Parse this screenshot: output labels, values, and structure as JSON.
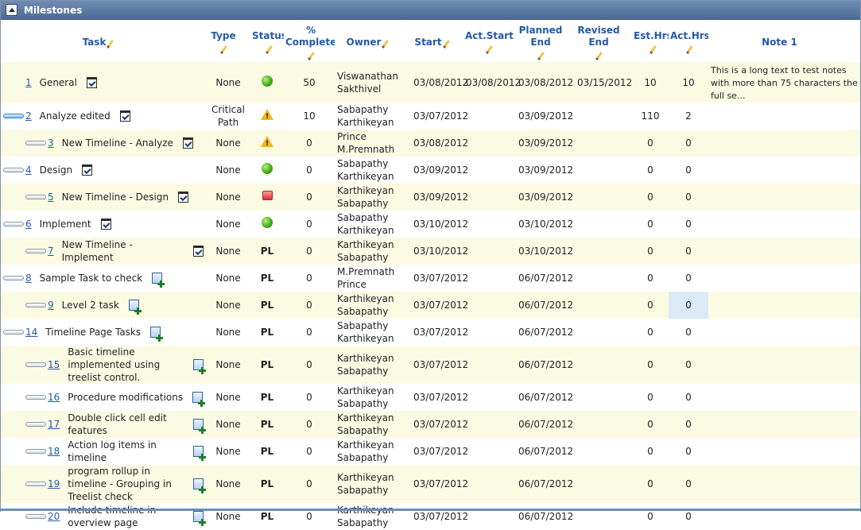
{
  "panel": {
    "title": "Milestones"
  },
  "columns": {
    "task": "Task",
    "type": "Type",
    "status": "Status",
    "complete": "% Complete",
    "owner": "Owner",
    "start": "Start",
    "act_start": "Act.Start",
    "planned_end": "Planned End",
    "revised_end": "Revised End",
    "est_hrs": "Est.Hrs",
    "act_hrs": "Act.Hrs",
    "note": "Note 1"
  },
  "rows": [
    {
      "num": "1",
      "name": "General",
      "icon": "checklist-icon",
      "expander": "none",
      "indent": 0,
      "type": "None",
      "status": "green",
      "status_text": "",
      "complete": "50",
      "owner": "Viswanathan Sakthivel",
      "start": "03/08/2012",
      "act_start": "03/08/2012",
      "planned_end": "03/08/2012",
      "revised_end": "03/15/2012",
      "est_hrs": "10",
      "act_hrs": "10",
      "note": "This is a long text to test notes with more than 75 characters the full se..."
    },
    {
      "num": "2",
      "name": "Analyze edited",
      "icon": "checklist-icon",
      "expander": "active",
      "indent": 0,
      "type": "Critical Path",
      "status": "warning",
      "status_text": "",
      "complete": "10",
      "owner": "Sabapathy Karthikeyan",
      "start": "03/07/2012",
      "act_start": "",
      "planned_end": "03/09/2012",
      "revised_end": "",
      "est_hrs": "110",
      "act_hrs": "2",
      "note": ""
    },
    {
      "num": "3",
      "name": "New Timeline - Analyze",
      "icon": "checklist-icon",
      "expander": "normal",
      "indent": 1,
      "type": "None",
      "status": "warning",
      "status_text": "",
      "complete": "0",
      "owner": "Prince M.Premnath",
      "start": "03/08/2012",
      "act_start": "",
      "planned_end": "03/09/2012",
      "revised_end": "",
      "est_hrs": "0",
      "act_hrs": "0",
      "note": ""
    },
    {
      "num": "4",
      "name": "Design",
      "icon": "checklist-icon",
      "expander": "normal",
      "indent": 0,
      "type": "None",
      "status": "green",
      "status_text": "",
      "complete": "0",
      "owner": "Sabapathy Karthikeyan",
      "start": "03/09/2012",
      "act_start": "",
      "planned_end": "03/09/2012",
      "revised_end": "",
      "est_hrs": "0",
      "act_hrs": "0",
      "note": ""
    },
    {
      "num": "5",
      "name": "New Timeline - Design",
      "icon": "checklist-icon",
      "expander": "normal",
      "indent": 1,
      "type": "None",
      "status": "red",
      "status_text": "",
      "complete": "0",
      "owner": "Karthikeyan Sabapathy",
      "start": "03/09/2012",
      "act_start": "",
      "planned_end": "03/09/2012",
      "revised_end": "",
      "est_hrs": "0",
      "act_hrs": "0",
      "note": ""
    },
    {
      "num": "6",
      "name": "Implement",
      "icon": "checklist-icon",
      "expander": "normal",
      "indent": 0,
      "type": "None",
      "status": "green",
      "status_text": "",
      "complete": "0",
      "owner": "Sabapathy Karthikeyan",
      "start": "03/10/2012",
      "act_start": "",
      "planned_end": "03/10/2012",
      "revised_end": "",
      "est_hrs": "0",
      "act_hrs": "0",
      "note": ""
    },
    {
      "num": "7",
      "name": "New Timeline - Implement",
      "icon": "checklist-icon",
      "expander": "normal",
      "indent": 1,
      "type": "None",
      "status": "text",
      "status_text": "PL",
      "complete": "0",
      "owner": "Karthikeyan Sabapathy",
      "start": "03/10/2012",
      "act_start": "",
      "planned_end": "03/10/2012",
      "revised_end": "",
      "est_hrs": "0",
      "act_hrs": "0",
      "note": ""
    },
    {
      "num": "8",
      "name": "Sample Task to check",
      "icon": "add-task-icon",
      "expander": "normal",
      "indent": 0,
      "type": "None",
      "status": "text",
      "status_text": "PL",
      "complete": "0",
      "owner": "M.Premnath Prince",
      "start": "03/07/2012",
      "act_start": "",
      "planned_end": "06/07/2012",
      "revised_end": "",
      "est_hrs": "0",
      "act_hrs": "0",
      "note": ""
    },
    {
      "num": "9",
      "name": "Level 2 task",
      "icon": "add-task-icon",
      "expander": "normal",
      "indent": 1,
      "type": "None",
      "status": "text",
      "status_text": "PL",
      "complete": "0",
      "owner": "Karthikeyan Sabapathy",
      "start": "03/07/2012",
      "act_start": "",
      "planned_end": "06/07/2012",
      "revised_end": "",
      "est_hrs": "0",
      "act_hrs": "0",
      "note": "",
      "selected_act_hrs": true
    },
    {
      "num": "14",
      "name": "Timeline Page Tasks",
      "icon": "add-task-icon",
      "expander": "normal",
      "indent": 0,
      "type": "None",
      "status": "text",
      "status_text": "PL",
      "complete": "0",
      "owner": "Sabapathy Karthikeyan",
      "start": "03/07/2012",
      "act_start": "",
      "planned_end": "06/07/2012",
      "revised_end": "",
      "est_hrs": "0",
      "act_hrs": "0",
      "note": ""
    },
    {
      "num": "15",
      "name": "Basic timeline implemented using treelist control.",
      "icon": "add-task-icon",
      "expander": "normal",
      "indent": 1,
      "type": "None",
      "status": "text",
      "status_text": "PL",
      "complete": "0",
      "owner": "Karthikeyan Sabapathy",
      "start": "03/07/2012",
      "act_start": "",
      "planned_end": "06/07/2012",
      "revised_end": "",
      "est_hrs": "0",
      "act_hrs": "0",
      "note": ""
    },
    {
      "num": "16",
      "name": "Procedure modifications",
      "icon": "add-task-icon",
      "expander": "normal",
      "indent": 1,
      "type": "None",
      "status": "text",
      "status_text": "PL",
      "complete": "0",
      "owner": "Karthikeyan Sabapathy",
      "start": "03/07/2012",
      "act_start": "",
      "planned_end": "06/07/2012",
      "revised_end": "",
      "est_hrs": "0",
      "act_hrs": "0",
      "note": ""
    },
    {
      "num": "17",
      "name": "Double click cell edit features",
      "icon": "add-task-icon",
      "expander": "normal",
      "indent": 1,
      "type": "None",
      "status": "text",
      "status_text": "PL",
      "complete": "0",
      "owner": "Karthikeyan Sabapathy",
      "start": "03/07/2012",
      "act_start": "",
      "planned_end": "06/07/2012",
      "revised_end": "",
      "est_hrs": "0",
      "act_hrs": "0",
      "note": ""
    },
    {
      "num": "18",
      "name": "Action log items in timeline",
      "icon": "add-task-icon",
      "expander": "normal",
      "indent": 1,
      "type": "None",
      "status": "text",
      "status_text": "PL",
      "complete": "0",
      "owner": "Karthikeyan Sabapathy",
      "start": "03/07/2012",
      "act_start": "",
      "planned_end": "06/07/2012",
      "revised_end": "",
      "est_hrs": "0",
      "act_hrs": "0",
      "note": ""
    },
    {
      "num": "19",
      "name": "program rollup in timeline - Grouping in Treelist check",
      "icon": "add-task-icon",
      "expander": "normal",
      "indent": 1,
      "type": "None",
      "status": "text",
      "status_text": "PL",
      "complete": "0",
      "owner": "Karthikeyan Sabapathy",
      "start": "03/07/2012",
      "act_start": "",
      "planned_end": "06/07/2012",
      "revised_end": "",
      "est_hrs": "0",
      "act_hrs": "0",
      "note": ""
    },
    {
      "num": "20",
      "name": "Include timeline in overview page",
      "icon": "add-task-icon",
      "expander": "normal",
      "indent": 1,
      "type": "None",
      "status": "text",
      "status_text": "PL",
      "complete": "0",
      "owner": "Karthikeyan Sabapathy",
      "start": "03/07/2012",
      "act_start": "",
      "planned_end": "06/07/2012",
      "revised_end": "",
      "est_hrs": "0",
      "act_hrs": "0",
      "note": ""
    }
  ]
}
